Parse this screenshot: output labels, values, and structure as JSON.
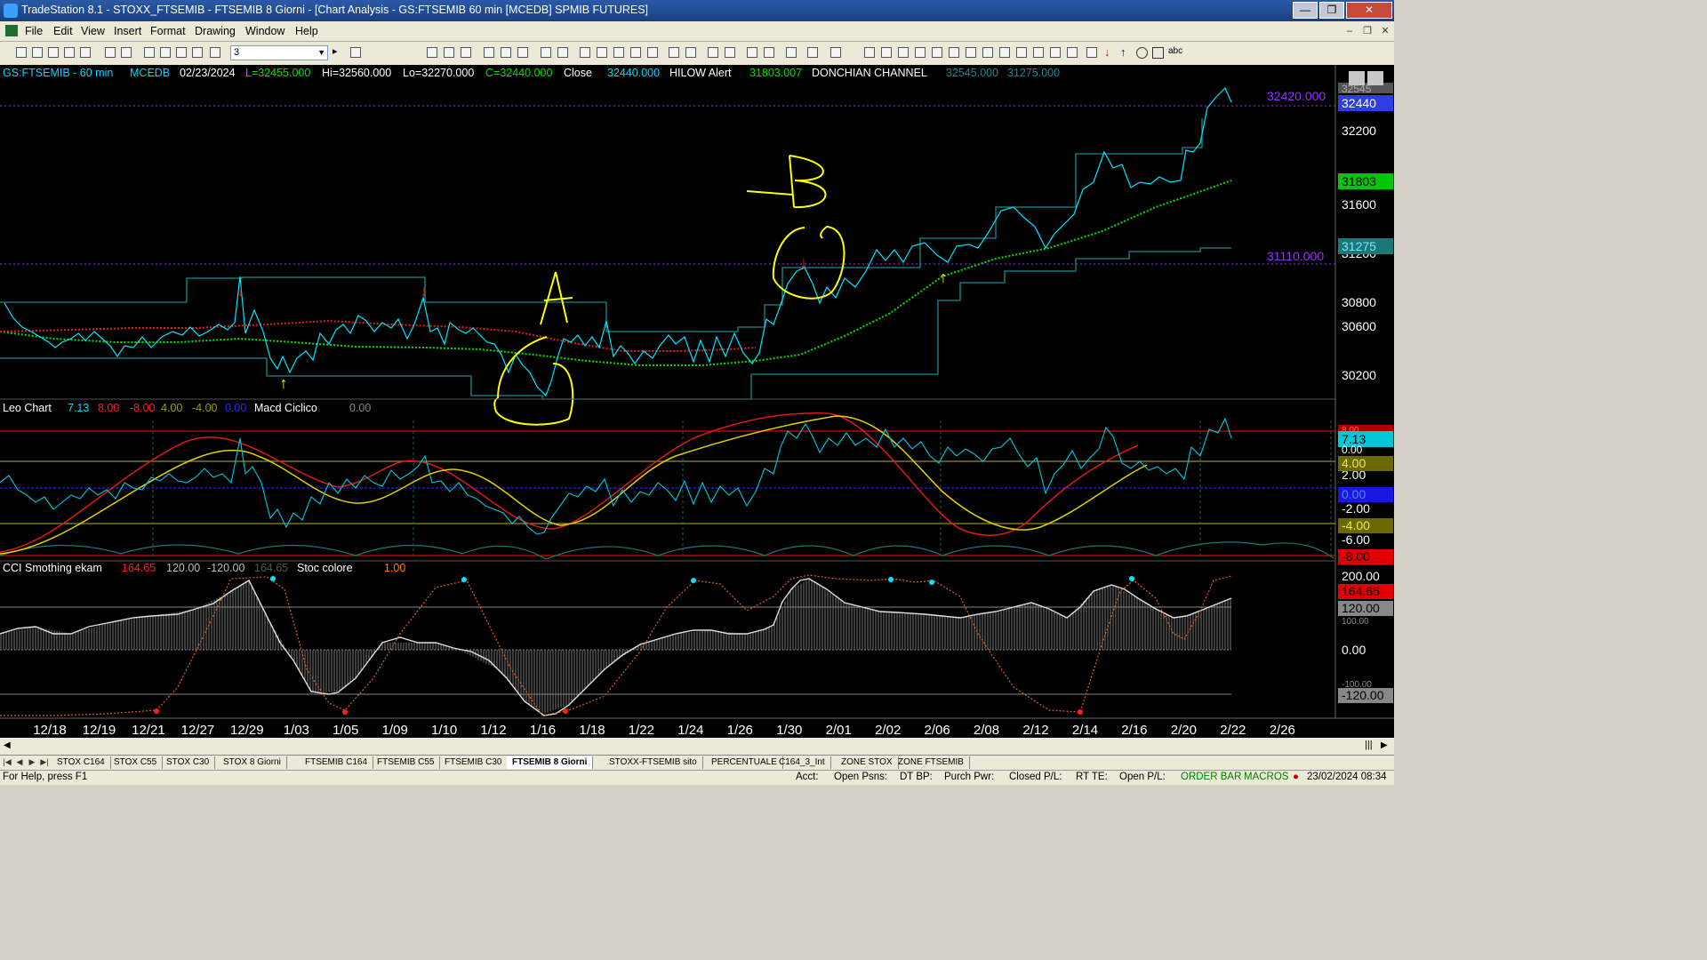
{
  "window": {
    "title": "TradeStation 8.1 - STOXX_FTSEMIB - FTSEMIB  8 Giorni - [Chart Analysis - GS:FTSEMIB  60 min  [MCEDB] SPMIB FUTURES]"
  },
  "menu": [
    "File",
    "Edit",
    "View",
    "Insert",
    "Format",
    "Drawing",
    "Window",
    "Help"
  ],
  "toolbar": {
    "interval_value": "3"
  },
  "price_header": {
    "symbol": "GS:FTSEMIB - 60 min",
    "feed": "MCEDB",
    "date": "02/23/2024",
    "last": "L=32455.000",
    "high": "Hi=32560.000",
    "low": "Lo=32270.000",
    "close": "C=32440.000",
    "close_label": "Close",
    "close_value": "32440.000",
    "hilow_label": "HILOW Alert",
    "hilow_value": "31803.007",
    "donchian_label": "DONCHIAN CHANNEL",
    "donchian_upper": "32545.000",
    "donchian_lower": "31275.000"
  },
  "price_axis": {
    "ticks": [
      "32200",
      "31600",
      "31200",
      "30800",
      "30600",
      "30200"
    ],
    "badges": [
      {
        "text": "32440",
        "bg": "#2e3ee0",
        "fg": "#ffffff"
      },
      {
        "text": "31803",
        "bg": "#00c800",
        "fg": "#000000"
      },
      {
        "text": "31275",
        "bg": "#1b7878",
        "fg": "#7fe6ff"
      }
    ],
    "top_partial": "32545",
    "level_32420": "32420.000",
    "level_31110": "31110.000"
  },
  "leo_header": {
    "name": "Leo Chart",
    "v1": "7.13",
    "v2": "8.00",
    "v3": "-8.00",
    "v4": "4.00",
    "v5": "-4.00",
    "v6": "0.00",
    "macd_label": "Macd Ciclico",
    "macd_value": "0.00"
  },
  "leo_axis": {
    "ticks": [
      "0.00",
      "2.00",
      "-2.00",
      "-6.00"
    ],
    "badges": [
      {
        "text": "7.13",
        "bg": "#00c8d8",
        "fg": "#000000"
      },
      {
        "text": "4.00",
        "bg": "#6a6a00",
        "fg": "#e8e860"
      },
      {
        "text": "0.00",
        "bg": "#1818e0",
        "fg": "#6080ff"
      },
      {
        "text": "-4.00",
        "bg": "#6a6a00",
        "fg": "#e8e860"
      },
      {
        "text": "-8.00",
        "bg": "#e00000",
        "fg": "#000000"
      }
    ],
    "top_partial": "8.00"
  },
  "cci_header": {
    "name": "CCI Smothing ekam",
    "v1": "164.65",
    "v2": "120.00",
    "v3": "-120.00",
    "v4": "164.65",
    "stoc_label": "Stoc colore",
    "stoc_value": "1.00"
  },
  "cci_axis": {
    "ticks": [
      "200.00",
      "100.00",
      "0.00",
      "-100.00"
    ],
    "badges": [
      {
        "text": "164.65",
        "bg": "#e00000",
        "fg": "#000000"
      },
      {
        "text": "120.00",
        "bg": "#888888",
        "fg": "#000000"
      },
      {
        "text": "-120.00",
        "bg": "#888888",
        "fg": "#000000"
      }
    ]
  },
  "date_axis": [
    "12/18",
    "12/19",
    "12/21",
    "12/27",
    "12/29",
    "1/03",
    "1/05",
    "1/09",
    "1/10",
    "1/12",
    "1/16",
    "1/18",
    "1/22",
    "1/24",
    "1/26",
    "1/30",
    "2/01",
    "2/02",
    "2/06",
    "2/08",
    "2/12",
    "2/14",
    "2/16",
    "2/20",
    "2/22",
    "2/26"
  ],
  "annotations": {
    "a": "A",
    "b": "B"
  },
  "tabs": [
    "STOX C164",
    "STOX C55",
    "STOX  C30",
    "STOX  8 Giorni",
    "FTSEMIB C164",
    "FTSEMIB C55",
    "FTSEMIB C30",
    "FTSEMIB  8 Giorni",
    "STOXX-FTSEMIB sito",
    "PERCENTUALE",
    "C164_3_Int",
    "ZONE STOX",
    "ZONE FTSEMIB"
  ],
  "active_tab": "FTSEMIB  8 Giorni",
  "status": {
    "help": "For Help, press F1",
    "acct": "Acct:",
    "open_psns": "Open Psns:",
    "dt_bp": "DT BP:",
    "purch_pwr": "Purch Pwr:",
    "closed_pl": "Closed P/L:",
    "rt_te": "RT TE:",
    "open_pl": "Open P/L:",
    "order_bar": "ORDER BAR",
    "macros": "MACROS",
    "datetime": "23/02/2024 08:34"
  },
  "colors": {
    "price": "#00e5ff",
    "label_cyan": "#00d8ff",
    "green": "#00e000",
    "red": "#ff2020",
    "yellow": "#ffff00",
    "purple": "#9b30ff",
    "annotation": "#ffff00"
  }
}
